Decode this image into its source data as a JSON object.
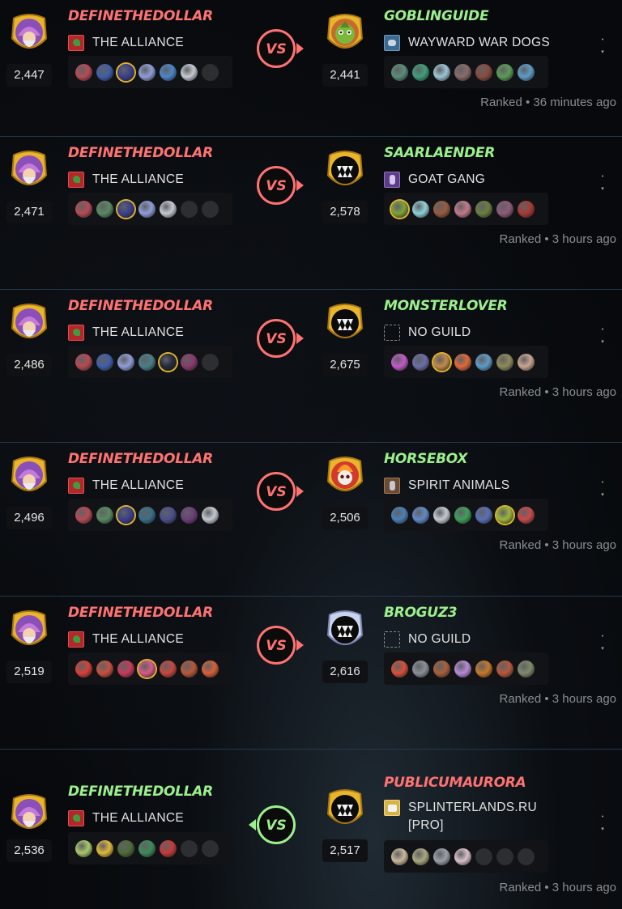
{
  "battles": [
    {
      "left": {
        "name": "DEFINETHEDOLLAR",
        "name_color": "red",
        "rating": "2,447",
        "guild": "THE ALLIANCE",
        "guild_icon": "flag",
        "badge": "wizard-badge",
        "team": [
          {
            "c": "#b74a55"
          },
          {
            "c": "#3f5fa8"
          },
          {
            "c": "#3a3f8f",
            "gold": true
          },
          {
            "c": "#8f9dd8"
          },
          {
            "c": "#4d86c8"
          },
          {
            "c": "#c4c9d2"
          },
          {
            "c": "empty"
          }
        ]
      },
      "right": {
        "name": "GOBLINGUIDE",
        "name_color": "green",
        "rating": "2,441",
        "guild": "WAYWARD WAR DOGS",
        "guild_icon": "dog",
        "badge": "goblin-badge",
        "team": [
          {
            "c": "#5a8d7a"
          },
          {
            "c": "#3f9f7c"
          },
          {
            "c": "#9cc6d6"
          },
          {
            "c": "#8a6b6b"
          },
          {
            "c": "#8a4b3f"
          },
          {
            "c": "#5a9c58"
          },
          {
            "c": "#5f9bc8"
          }
        ]
      },
      "winner": "left",
      "vs_label": "VS",
      "result": "Ranked • 36 minutes ago"
    },
    {
      "left": {
        "name": "DEFINETHEDOLLAR",
        "name_color": "red",
        "rating": "2,471",
        "guild": "THE ALLIANCE",
        "guild_icon": "flag",
        "badge": "wizard-badge",
        "team": [
          {
            "c": "#b74a55"
          },
          {
            "c": "#5a8a62"
          },
          {
            "c": "#3a3f8f",
            "gold": true
          },
          {
            "c": "#8f9dd8"
          },
          {
            "c": "#c4c9d2"
          },
          {
            "c": "empty"
          },
          {
            "c": "empty"
          }
        ]
      },
      "right": {
        "name": "SAARLAENDER",
        "name_color": "green",
        "rating": "2,578",
        "guild": "GOAT GANG",
        "guild_icon": "goat",
        "badge": "fang-badge",
        "team": [
          {
            "c": "#7fa33a",
            "gold": true
          },
          {
            "c": "#8fd0d8"
          },
          {
            "c": "#9a5a3f"
          },
          {
            "c": "#c47a8a"
          },
          {
            "c": "#6b7f3f"
          },
          {
            "c": "#8f5a7a"
          },
          {
            "c": "#a83a35"
          }
        ]
      },
      "winner": "left",
      "vs_label": "VS",
      "result": "Ranked • 3 hours ago"
    },
    {
      "left": {
        "name": "DEFINETHEDOLLAR",
        "name_color": "red",
        "rating": "2,486",
        "guild": "THE ALLIANCE",
        "guild_icon": "flag",
        "badge": "wizard-badge",
        "team": [
          {
            "c": "#b74a55"
          },
          {
            "c": "#3f5fa8"
          },
          {
            "c": "#8f9dd8"
          },
          {
            "c": "#4a7f8a"
          },
          {
            "c": "#242a3f",
            "gold": true
          },
          {
            "c": "#8a3a6b"
          },
          {
            "c": "empty"
          }
        ]
      },
      "right": {
        "name": "MONSTERLOVER",
        "name_color": "green",
        "rating": "2,675",
        "guild": "NO GUILD",
        "guild_icon": "none",
        "badge": "fang-badge",
        "team": [
          {
            "c": "#c25ac8"
          },
          {
            "c": "#6b6fa8"
          },
          {
            "c": "#c28a4a",
            "gold": true
          },
          {
            "c": "#e0683a"
          },
          {
            "c": "#5f9bc8"
          },
          {
            "c": "#8f8a5a"
          },
          {
            "c": "#c9a58f"
          }
        ]
      },
      "winner": "left",
      "vs_label": "VS",
      "result": "Ranked • 3 hours ago"
    },
    {
      "left": {
        "name": "DEFINETHEDOLLAR",
        "name_color": "red",
        "rating": "2,496",
        "guild": "THE ALLIANCE",
        "guild_icon": "flag",
        "badge": "wizard-badge",
        "team": [
          {
            "c": "#b74a55"
          },
          {
            "c": "#5a8a62"
          },
          {
            "c": "#3a3f8f",
            "gold": true
          },
          {
            "c": "#3a6f8a"
          },
          {
            "c": "#4a4f8f"
          },
          {
            "c": "#6b3f7a"
          },
          {
            "c": "#c4c9d2"
          }
        ]
      },
      "right": {
        "name": "HORSEBOX",
        "name_color": "green",
        "rating": "2,506",
        "guild": "SPIRIT ANIMALS",
        "guild_icon": "spirit",
        "badge": "skull-badge",
        "team": [
          {
            "c": "#4a7fb8"
          },
          {
            "c": "#5f8ac8"
          },
          {
            "c": "#c4c9d2"
          },
          {
            "c": "#3f9f5a"
          },
          {
            "c": "#5a6fb8"
          },
          {
            "c": "#9ab83a",
            "gold": true
          },
          {
            "c": "#c84a4a"
          }
        ]
      },
      "winner": "left",
      "vs_label": "VS",
      "result": "Ranked • 3 hours ago"
    },
    {
      "left": {
        "name": "DEFINETHEDOLLAR",
        "name_color": "red",
        "rating": "2,519",
        "guild": "THE ALLIANCE",
        "guild_icon": "flag",
        "badge": "wizard-badge",
        "team": [
          {
            "c": "#d8403a"
          },
          {
            "c": "#c8503f"
          },
          {
            "c": "#c83a5a"
          },
          {
            "c": "#d85a8a",
            "gold": true
          },
          {
            "c": "#c8483f"
          },
          {
            "c": "#b8583a"
          },
          {
            "c": "#d8603a"
          }
        ]
      },
      "right": {
        "name": "BROGUZ3",
        "name_color": "green",
        "rating": "2,616",
        "guild": "NO GUILD",
        "guild_icon": "none",
        "badge": "fang-badge-silver",
        "team": [
          {
            "c": "#d8503a"
          },
          {
            "c": "#8a8f9a"
          },
          {
            "c": "#a8603a"
          },
          {
            "c": "#b88ad8"
          },
          {
            "c": "#c8782a"
          },
          {
            "c": "#b8583a"
          },
          {
            "c": "#7f8a6b"
          }
        ]
      },
      "winner": "left",
      "vs_label": "VS",
      "result": "Ranked • 3 hours ago"
    },
    {
      "left": {
        "name": "DEFINETHEDOLLAR",
        "name_color": "green",
        "rating": "2,536",
        "guild": "THE ALLIANCE",
        "guild_icon": "flag",
        "badge": "wizard-badge",
        "team": [
          {
            "c": "#a8c86b"
          },
          {
            "c": "#e0b83a"
          },
          {
            "c": "#4f6b3a"
          },
          {
            "c": "#3f8a5a"
          },
          {
            "c": "#c83a3a"
          },
          {
            "c": "empty"
          },
          {
            "c": "empty"
          }
        ]
      },
      "right": {
        "name": "PUBLICUMAURORA",
        "name_color": "red",
        "rating": "2,517",
        "guild": "SPLINTERLANDS.RU [PRO]",
        "guild_icon": "ru",
        "badge": "fang-badge",
        "team": [
          {
            "c": "#c8b89a"
          },
          {
            "c": "#a8a87f"
          },
          {
            "c": "#9aa0a8"
          },
          {
            "c": "#d8c0c8"
          },
          {
            "c": "empty"
          },
          {
            "c": "empty"
          },
          {
            "c": "empty"
          }
        ]
      },
      "winner": "right",
      "vs_label": "VS",
      "result": "Ranked • 3 hours ago"
    }
  ],
  "menu_glyphs": [
    "•",
    "▾"
  ],
  "colors": {
    "red_name": "#ff7272",
    "green_name": "#9cf08c",
    "vs_red": "#ff7272",
    "vs_green": "#9cf08c",
    "badge_gold": "#e8b52c",
    "divider": "#25394a"
  }
}
